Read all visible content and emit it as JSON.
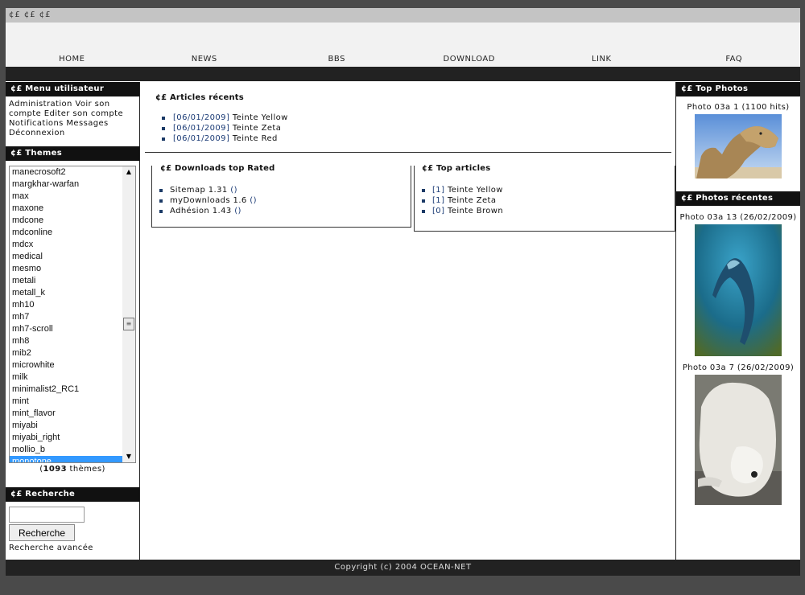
{
  "topbar": {
    "text": "¢£ ¢£ ¢£"
  },
  "nav": [
    "HOME",
    "NEWS",
    "BBS",
    "DOWNLOAD",
    "LINK",
    "FAQ"
  ],
  "user_menu": {
    "title": "¢£ Menu utilisateur",
    "links": [
      "Administration",
      "Voir son compte",
      "Editer son compte",
      "Notifications",
      "Messages",
      "Déconnexion"
    ]
  },
  "themes": {
    "title": "¢£ Themes",
    "items": [
      "manecrosoft2",
      "margkhar-warfan",
      "max",
      "maxone",
      "mdcone",
      "mdconline",
      "mdcx",
      "medical",
      "mesmo",
      "metali",
      "metall_k",
      "mh10",
      "mh7",
      "mh7-scroll",
      "mh8",
      "mib2",
      "microwhite",
      "milk",
      "minimalist2_RC1",
      "mint",
      "mint_flavor",
      "miyabi",
      "miyabi_right",
      "mollio_b",
      "monotone"
    ],
    "selected": "monotone",
    "count_prefix": "(",
    "count": "1093",
    "count_suffix": " thèmes)"
  },
  "search": {
    "title": "¢£ Recherche",
    "value": "",
    "button": "Recherche",
    "advanced": "Recherche avancée"
  },
  "recent_articles": {
    "title": "¢£ Articles récents",
    "items": [
      {
        "date": "[06/01/2009]",
        "title": "Teinte Yellow"
      },
      {
        "date": "[06/01/2009]",
        "title": "Teinte Zeta"
      },
      {
        "date": "[06/01/2009]",
        "title": "Teinte Red"
      }
    ]
  },
  "downloads": {
    "title": "¢£ Downloads top Rated",
    "items": [
      {
        "name": "Sitemap 1.31",
        "extra": "()"
      },
      {
        "name": "myDownloads 1.6",
        "extra": "()"
      },
      {
        "name": "Adhésion 1.43",
        "extra": "()"
      }
    ]
  },
  "top_articles": {
    "title": "¢£ Top articles",
    "items": [
      {
        "count": "[1]",
        "title": "Teinte Yellow"
      },
      {
        "count": "[1]",
        "title": "Teinte Zeta"
      },
      {
        "count": "[0]",
        "title": "Teinte Brown"
      }
    ]
  },
  "top_photos": {
    "title": "¢£ Top Photos",
    "caption": "Photo 03a 1 (1100 hits)"
  },
  "recent_photos": {
    "title": "¢£ Photos récentes",
    "items": [
      {
        "caption": "Photo 03a 13 (26/02/2009)"
      },
      {
        "caption": "Photo 03a 7 (26/02/2009)"
      }
    ]
  },
  "footer": {
    "text": "Copyright (c) 2004 OCEAN-NET"
  },
  "colors": {
    "selected": "#3399ff",
    "link": "#1a3a75",
    "dark": "#111111",
    "nav_bg": "#f2f2f2"
  }
}
